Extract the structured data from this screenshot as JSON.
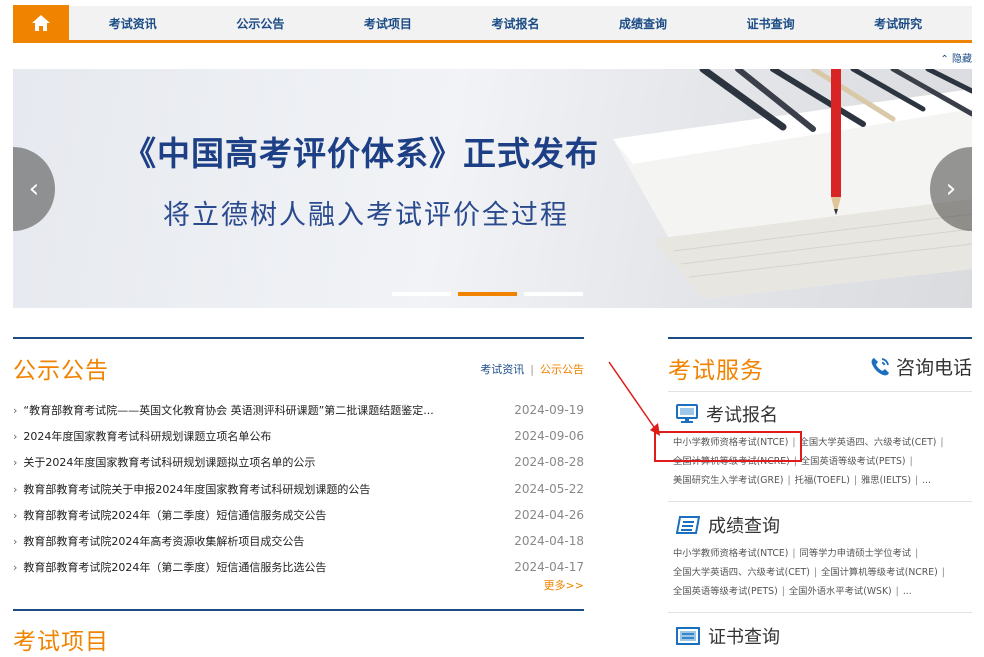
{
  "nav": {
    "items": [
      "考试资讯",
      "公示公告",
      "考试项目",
      "考试报名",
      "成绩查询",
      "证书查询",
      "考试研究"
    ]
  },
  "hide_label": "隐藏",
  "banner": {
    "title": "《中国高考评价体系》正式发布",
    "subtitle": "将立德树人融入考试评价全过程",
    "left_arrow": "‹",
    "right_arrow": "›",
    "active_slide": 2,
    "slide_count": 3
  },
  "announcements": {
    "title": "公示公告",
    "tab1": "考试资讯",
    "tab_sep": "|",
    "tab2": "公示公告",
    "items": [
      {
        "title": "“教育部教育考试院——英国文化教育协会 英语测评科研课题”第二批课题结题鉴定...",
        "date": "2024-09-19"
      },
      {
        "title": "2024年度国家教育考试科研规划课题立项名单公布",
        "date": "2024-09-06"
      },
      {
        "title": "关于2024年度国家教育考试科研规划课题拟立项名单的公示",
        "date": "2024-08-28"
      },
      {
        "title": "教育部教育考试院关于申报2024年度国家教育考试科研规划课题的公告",
        "date": "2024-05-22"
      },
      {
        "title": "教育部教育考试院2024年（第二季度）短信通信服务成交公告",
        "date": "2024-04-26"
      },
      {
        "title": "教育部教育考试院2024年高考资源收集解析项目成交公告",
        "date": "2024-04-18"
      },
      {
        "title": "教育部教育考试院2024年（第二季度）短信通信服务比选公告",
        "date": "2024-04-17"
      }
    ],
    "more": "更多>>"
  },
  "projects": {
    "title": "考试项目"
  },
  "services": {
    "title": "考试服务",
    "hotline": "咨询电话",
    "registration": {
      "title": "考试报名",
      "line1": [
        "中小学教师资格考试(NTCE)",
        "全国大学英语四、六级考试(CET)",
        ""
      ],
      "line2": [
        "全国计算机等级考试(NCRE)",
        "全国英语等级考试(PETS)",
        ""
      ],
      "line3": [
        "美国研究生入学考试(GRE)",
        "托福(TOEFL)",
        "雅思(IELTS)",
        "..."
      ]
    },
    "scores": {
      "title": "成绩查询",
      "line1": [
        "中小学教师资格考试(NTCE)",
        "同等学力申请硕士学位考试",
        ""
      ],
      "line2": [
        "全国大学英语四、六级考试(CET)",
        "全国计算机等级考试(NCRE)",
        ""
      ],
      "line3": [
        "全国英语等级考试(PETS)",
        "全国外语水平考试(WSK)",
        "..."
      ]
    },
    "certificates": {
      "title": "证书查询"
    }
  },
  "colors": {
    "accent": "#f08300",
    "navy": "#1b4c86",
    "highlight": "#e01b1b"
  }
}
